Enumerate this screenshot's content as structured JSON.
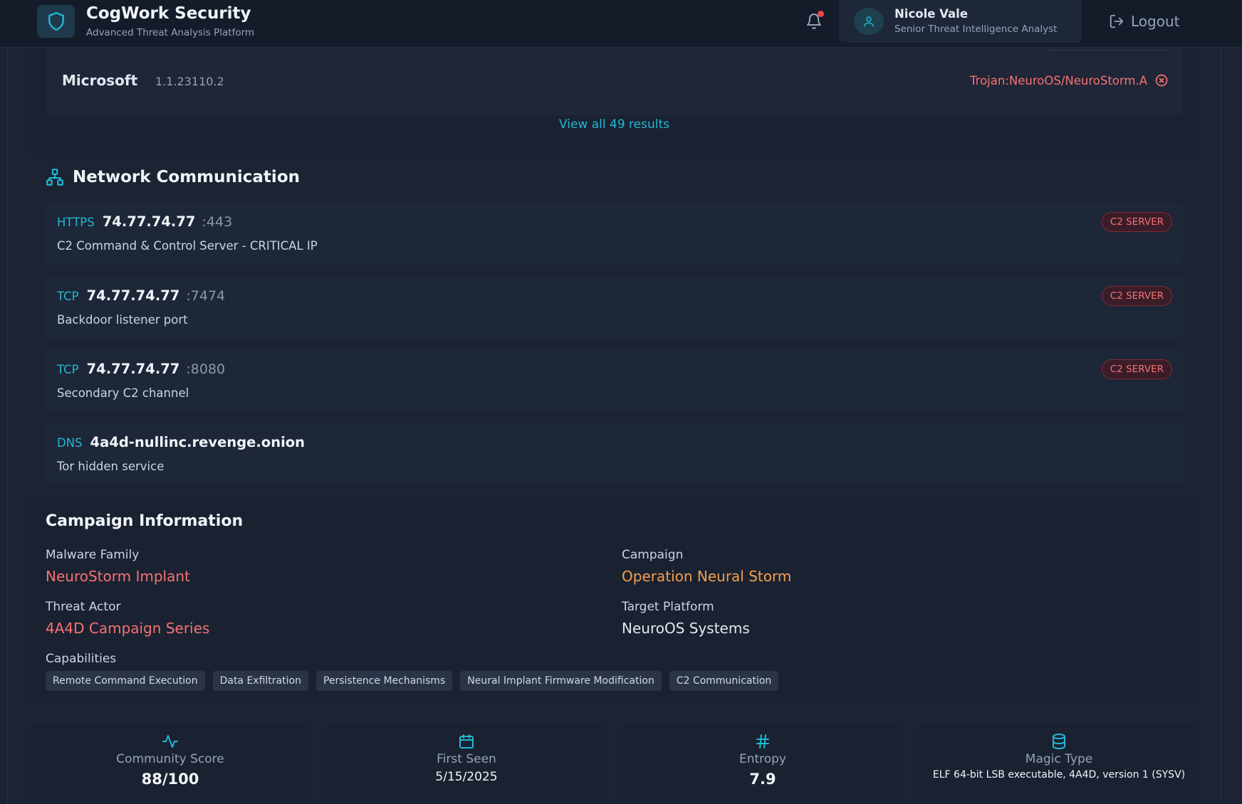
{
  "header": {
    "title": "CogWork Security",
    "subtitle": "Advanced Threat Analysis Platform",
    "user_name": "Nicole Vale",
    "user_role": "Senior Threat Intelligence Analyst",
    "logout_label": "Logout",
    "has_notification": true
  },
  "antivirus": {
    "row": {
      "vendor": "Microsoft",
      "version": "1.1.23110.2",
      "result": "Trojan:NeuroOS/NeuroStorm.A"
    },
    "view_all_label": "View all 49 results"
  },
  "network": {
    "title": "Network Communication",
    "connections": [
      {
        "protocol": "HTTPS",
        "host": "74.77.74.77",
        "port": ":443",
        "description": "C2 Command & Control Server - CRITICAL IP",
        "badge": "C2 SERVER"
      },
      {
        "protocol": "TCP",
        "host": "74.77.74.77",
        "port": ":7474",
        "description": "Backdoor listener port",
        "badge": "C2 SERVER"
      },
      {
        "protocol": "TCP",
        "host": "74.77.74.77",
        "port": ":8080",
        "description": "Secondary C2 channel",
        "badge": "C2 SERVER"
      },
      {
        "protocol": "DNS",
        "host": "4a4d-nullinc.revenge.onion",
        "port": "",
        "description": "Tor hidden service",
        "badge": ""
      }
    ]
  },
  "campaign": {
    "title": "Campaign Information",
    "malware_family_label": "Malware Family",
    "malware_family": "NeuroStorm Implant",
    "campaign_label": "Campaign",
    "campaign": "Operation Neural Storm",
    "threat_actor_label": "Threat Actor",
    "threat_actor": "4A4D Campaign Series",
    "target_platform_label": "Target Platform",
    "target_platform": "NeuroOS Systems",
    "capabilities_label": "Capabilities",
    "capabilities": [
      "Remote Command Execution",
      "Data Exfiltration",
      "Persistence Mechanisms",
      "Neural Implant Firmware Modification",
      "C2 Communication"
    ]
  },
  "stats": [
    {
      "icon": "activity-icon",
      "label": "Community Score",
      "value": "88/100"
    },
    {
      "icon": "calendar-icon",
      "label": "First Seen",
      "value": "5/15/2025"
    },
    {
      "icon": "hash-icon",
      "label": "Entropy",
      "value": "7.9"
    },
    {
      "icon": "database-icon",
      "label": "Magic Type",
      "value": "ELF 64-bit LSB executable, 4A4D, version 1 (SYSV)"
    }
  ],
  "colors": {
    "accent": "#22b8d4",
    "danger": "#f87171",
    "warning": "#f59e4b",
    "background": "#1c2433",
    "panel": "#1a2231"
  }
}
